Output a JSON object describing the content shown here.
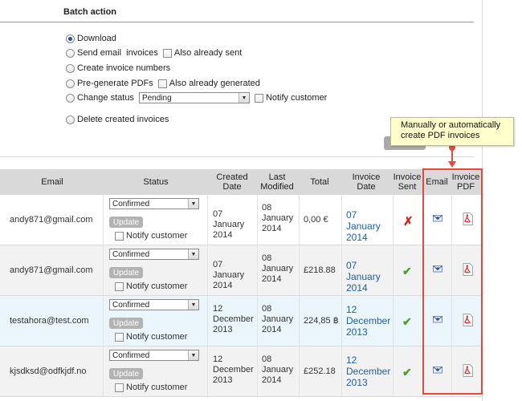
{
  "batch": {
    "title": "Batch action",
    "options": {
      "download": "Download",
      "send_email": "Send email  invoices",
      "also_already_sent": "Also already sent",
      "create_numbers": "Create invoice numbers",
      "pregenerate": "Pre-generate PDFs",
      "also_already_generated": "Also already generated",
      "change_status": "Change status",
      "status_value": "Pending",
      "notify_customer": "Notify customer",
      "delete_created": "Delete created invoices"
    },
    "selected_option": "download"
  },
  "callout": {
    "text_line1": "Manually or automatically",
    "text_line2": "create PDF invoices"
  },
  "table": {
    "headers": {
      "email": "Email",
      "status": "Status",
      "created": "Created Date",
      "modified": "Last Modified",
      "total": "Total",
      "invoice_date": "Invoice Date",
      "invoice_sent": "Invoice Sent",
      "email_col": "Email",
      "invoice_pdf": "Invoice PDF"
    },
    "update_label": "Update",
    "notify_label": "Notify customer",
    "rows": [
      {
        "email": "andy871@gmail.com",
        "status": "Confirmed",
        "created": "07 January 2014",
        "modified": "08 January 2014",
        "total": "0,00 €",
        "invoice_date": "07 January 2014",
        "sent": "no"
      },
      {
        "email": "andy871@gmail.com",
        "status": "Confirmed",
        "created": "07 January 2014",
        "modified": "08 January 2014",
        "total": "£218.88",
        "invoice_date": "07 January 2014",
        "sent": "yes"
      },
      {
        "email": "testahora@test.com",
        "status": "Confirmed",
        "created": "12 December 2013",
        "modified": "08 January 2014",
        "total": "224,85 ฿",
        "invoice_date": "12 December 2013",
        "sent": "yes"
      },
      {
        "email": "kjsdksd@odfkjdf.no",
        "status": "Confirmed",
        "created": "12 December 2013",
        "modified": "08 January 2014",
        "total": "£252.18",
        "invoice_date": "12 December 2013",
        "sent": "yes"
      }
    ]
  },
  "colors": {
    "accent_red": "#e24b3b",
    "link_blue": "#1f5f9f",
    "check_green": "#4aa02c",
    "header_gray": "#d9d9d9"
  }
}
